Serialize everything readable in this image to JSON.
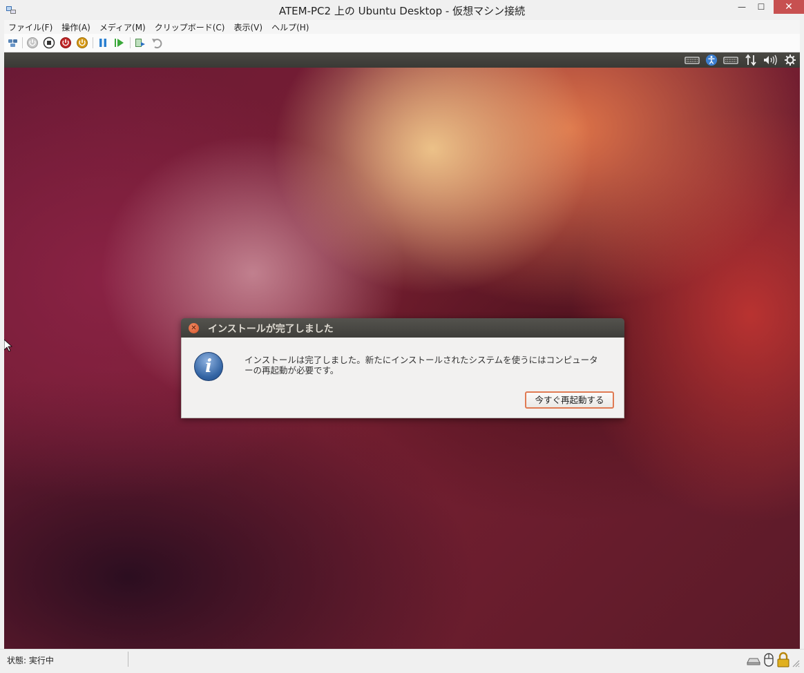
{
  "window": {
    "title": "ATEM-PC2 上の Ubuntu Desktop  - 仮想マシン接続",
    "minimize_glyph": "—",
    "maximize_glyph": "☐",
    "close_glyph": "✕"
  },
  "menu": {
    "items": [
      "ファイル(F)",
      "操作(A)",
      "メディア(M)",
      "クリップボード(C)",
      "表示(V)",
      "ヘルプ(H)"
    ]
  },
  "toolbar": {
    "buttons": [
      "ctrl-alt-del-icon",
      "start-icon",
      "turn-off-icon",
      "shut-down-icon",
      "save-icon",
      "pause-icon",
      "reset-icon",
      "checkpoint-icon",
      "revert-icon"
    ]
  },
  "ubuntu_panel": {
    "indicators": [
      "keyboard-icon",
      "accessibility-icon",
      "keyboard-layout-icon",
      "network-icon",
      "volume-icon",
      "settings-gear-icon"
    ]
  },
  "dialog": {
    "title": "インストールが完了しました",
    "close_glyph": "✕",
    "info_glyph": "i",
    "message_line1": "インストールは完了しました。新たにインストールされたシステムを使うにはコンピュータ",
    "message_line2": "ーの再起動が必要です。",
    "restart_button": "今すぐ再起動する"
  },
  "status": {
    "text": "状態: 実行中",
    "icons": [
      "keyboard-status-icon",
      "mouse-status-icon",
      "lock-status-icon"
    ]
  },
  "colors": {
    "accent_orange": "#e07a52",
    "close_red": "#c75050",
    "panel_dark": "#3f3e3a"
  }
}
